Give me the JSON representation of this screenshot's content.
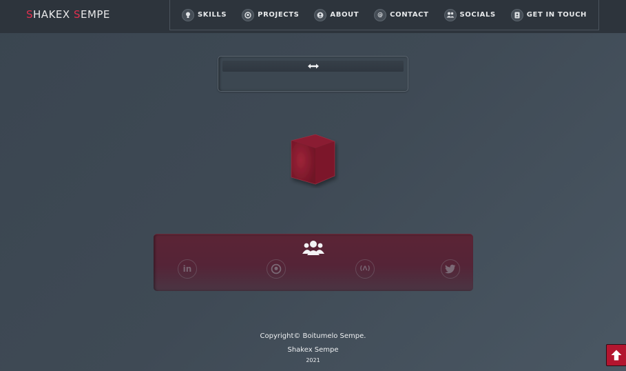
{
  "brand": {
    "initial_1": "S",
    "rest_1": "HAKEX ",
    "initial_2": "S",
    "rest_2": "EMPE"
  },
  "nav": {
    "items": [
      {
        "label": "SKILLS",
        "icon": "lightbulb-icon"
      },
      {
        "label": "PROJECTS",
        "icon": "github-icon"
      },
      {
        "label": "ABOUT",
        "icon": "user-circle-icon"
      },
      {
        "label": "CONTACT",
        "icon": "at-icon"
      },
      {
        "label": "SOCIALS",
        "icon": "users-icon"
      },
      {
        "label": "GET IN TOUCH",
        "icon": "address-book-icon"
      }
    ]
  },
  "resize_panel": {
    "icon": "horizontal-arrows-icon"
  },
  "cube": {
    "icon": "3d-cube",
    "color": "#8e1a30"
  },
  "socials": {
    "header_icon": "users-icon",
    "links": [
      {
        "icon": "linkedin-icon",
        "glyph": "in"
      },
      {
        "icon": "github-icon",
        "glyph": ""
      },
      {
        "icon": "freecodecamp-icon",
        "glyph": "(Λ)"
      },
      {
        "icon": "twitter-icon",
        "glyph": ""
      }
    ]
  },
  "footer": {
    "copyright": "Copyright© Boitumelo Sempe.",
    "name": "Shakex Sempe",
    "year": "2021"
  },
  "colors": {
    "accent": "#e0304f",
    "topbar": "#2d343c",
    "background": "#3f4a55",
    "social_panel": "#552437",
    "scroll_button": "#b3152f"
  }
}
